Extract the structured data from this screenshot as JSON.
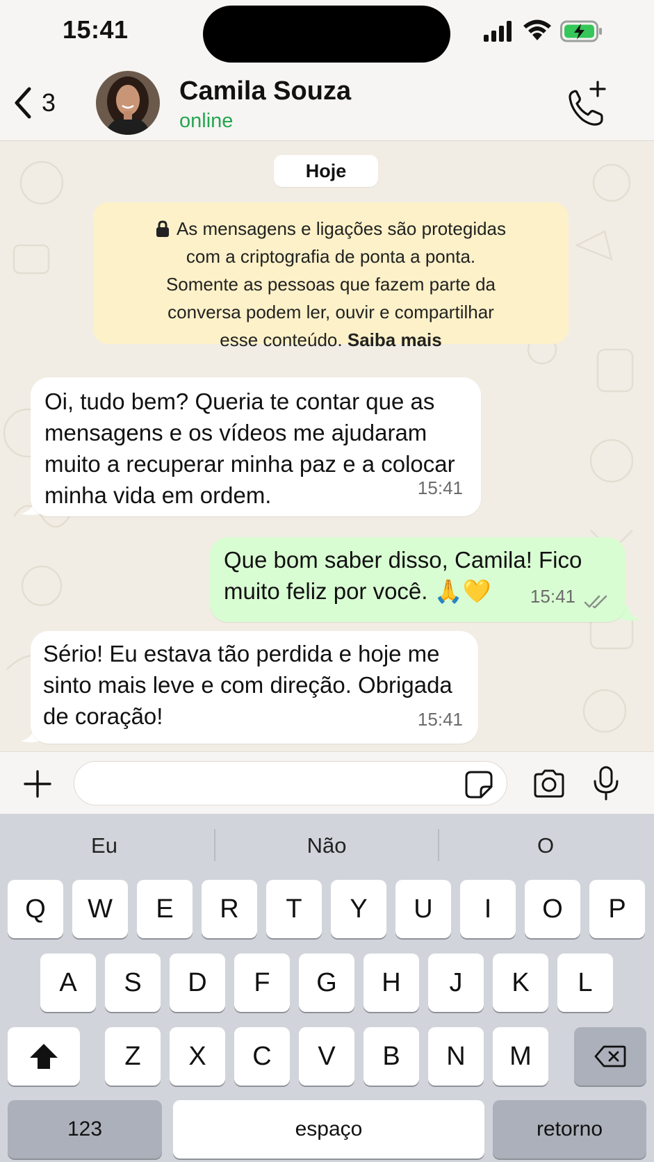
{
  "status_bar": {
    "time": "15:41"
  },
  "header": {
    "back_count": "3",
    "contact_name": "Camila Souza",
    "contact_status": "online"
  },
  "chat": {
    "date_label": "Hoje",
    "encryption_notice": {
      "text": "As mensagens e ligações são protegidas com a criptografia de ponta a ponta. Somente as pessoas que fazem parte da conversa podem ler, ouvir e compartilhar esse conteúdo.",
      "line1": "As mensagens e ligações são protegidas",
      "line2": "com a criptografia de ponta a ponta.",
      "line3": "Somente as pessoas que fazem parte da",
      "line4": "conversa podem ler, ouvir e compartilhar",
      "line5": "esse conteúdo.",
      "link": "Saiba mais"
    },
    "messages": [
      {
        "direction": "incoming",
        "text": "Oi, tudo bem? Queria te contar que as mensagens e os vídeos me ajudaram muito a recuperar minha paz e a colocar minha vida em ordem.",
        "time": "15:41"
      },
      {
        "direction": "outgoing",
        "text": "Que bom saber disso, Camila! Fico muito feliz por você. 🙏💛",
        "time": "15:41",
        "status": "read"
      },
      {
        "direction": "incoming",
        "text": "Sério! Eu estava tão perdida e hoje me sinto mais leve e com direção. Obrigada de coração!",
        "time": "15:41"
      }
    ]
  },
  "composer": {
    "placeholder": ""
  },
  "keyboard": {
    "suggestions": [
      "Eu",
      "Não",
      "O"
    ],
    "row1": [
      "Q",
      "W",
      "E",
      "R",
      "T",
      "Y",
      "U",
      "I",
      "O",
      "P"
    ],
    "row2": [
      "A",
      "S",
      "D",
      "F",
      "G",
      "H",
      "J",
      "K",
      "L"
    ],
    "row3": [
      "Z",
      "X",
      "C",
      "V",
      "B",
      "N",
      "M"
    ],
    "numbers_label": "123",
    "space_label": "espaço",
    "return_label": "retorno"
  },
  "colors": {
    "online_green": "#25a550",
    "outgoing_bubble": "#d9fdd3",
    "notice_bg": "#fcf1c8",
    "chat_bg": "#f2ede4"
  }
}
